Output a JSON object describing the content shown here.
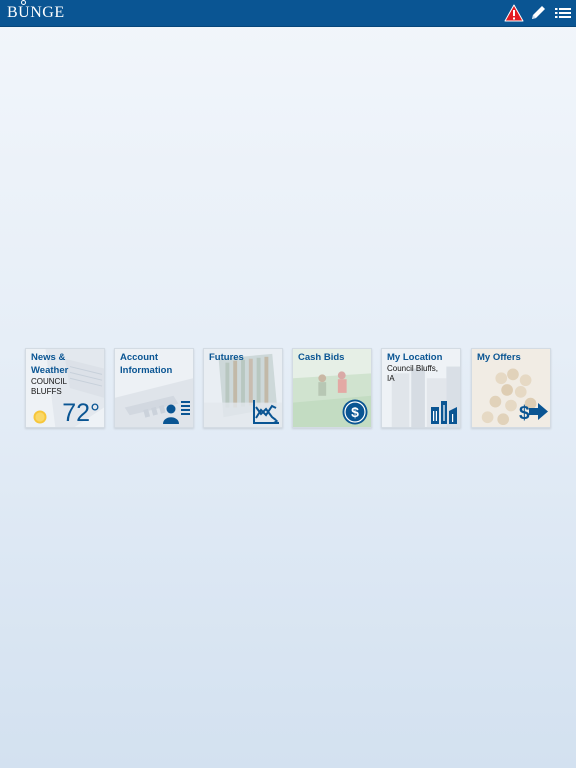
{
  "header": {
    "logo_text_b": "B",
    "logo_text_u": "U",
    "logo_text_rest": "NGE",
    "icons": [
      "alert-icon",
      "pencil-icon",
      "list-icon"
    ],
    "bar_color": "#0a5593",
    "alert_color": "#e31b23"
  },
  "tiles": [
    {
      "id": "news-weather",
      "title": "News & Weather",
      "subtitle": "COUNCIL BLUFFS",
      "temperature": "72°",
      "icon": "sun-icon"
    },
    {
      "id": "account-information",
      "title": "Account Information",
      "icon": "account-profile-icon"
    },
    {
      "id": "futures",
      "title": "Futures",
      "icon": "futures-chart-icon"
    },
    {
      "id": "cash-bids",
      "title": "Cash Bids",
      "icon": "dollar-coin-icon"
    },
    {
      "id": "my-location",
      "title": "My Location",
      "subtitle": "Council Bluffs, IA",
      "icon": "grain-elevator-icon"
    },
    {
      "id": "my-offers",
      "title": "My Offers",
      "icon": "dollar-arrow-icon"
    }
  ],
  "accent_color": "#0a5593"
}
